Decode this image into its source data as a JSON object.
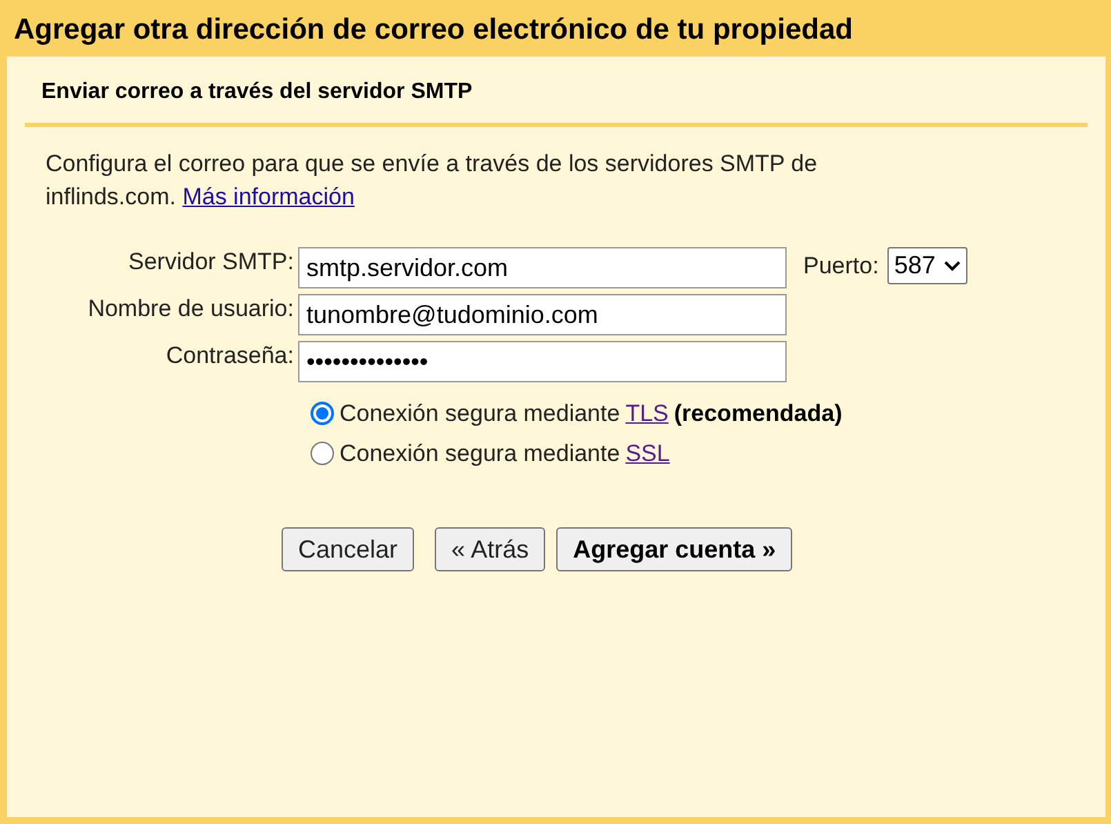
{
  "title": "Agregar otra dirección de correo electrónico de tu propiedad",
  "section_title": "Enviar correo a través del servidor SMTP",
  "intro": {
    "text": "Configura el correo para que se envíe a través de los servidores SMTP de inflinds.com.",
    "link": "Más información"
  },
  "fields": [
    {
      "label": "Servidor SMTP:",
      "value": "smtp.servidor.com"
    },
    {
      "label": "Nombre de usuario:",
      "value": "tunombre@tudominio.com"
    },
    {
      "label": "Contraseña:",
      "value": "••••••••••••••"
    }
  ],
  "port": {
    "label": "Puerto:",
    "value": "587"
  },
  "security_options": [
    {
      "text": "Conexión segura mediante",
      "link": "TLS",
      "note": "(recomendada)",
      "selected": true
    },
    {
      "text": "Conexión segura mediante",
      "link": "SSL",
      "selected": false
    }
  ],
  "buttons": [
    {
      "label": "Cancelar",
      "bold": false
    },
    {
      "label": "« Atrás",
      "bold": false
    },
    {
      "label": "Agregar cuenta »",
      "bold": true
    }
  ]
}
